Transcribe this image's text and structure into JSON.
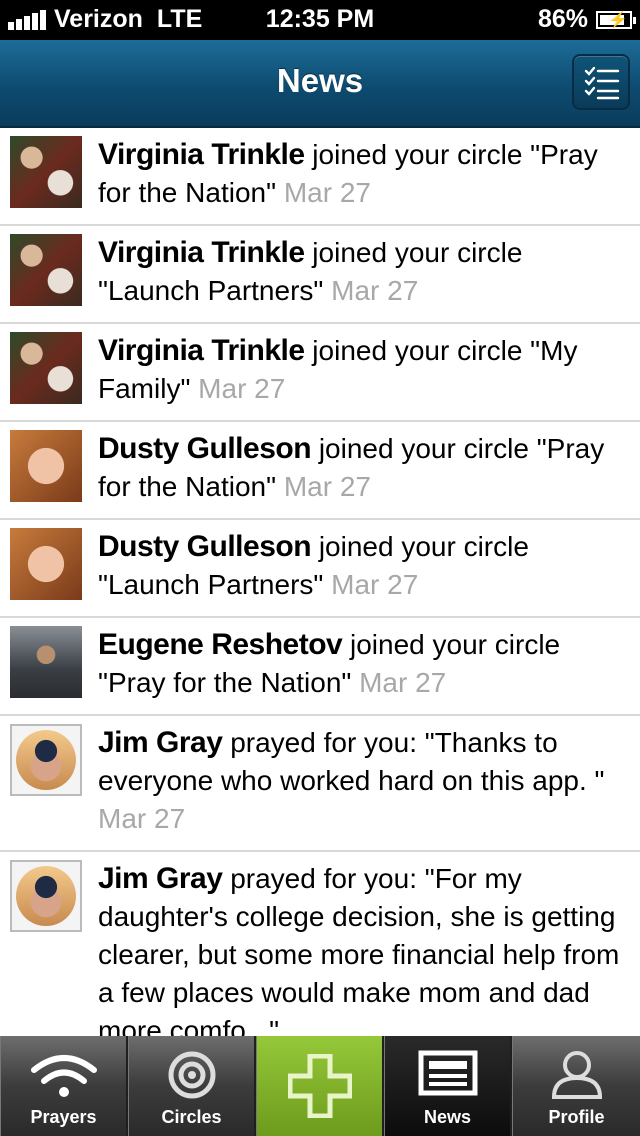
{
  "status": {
    "carrier": "Verizon",
    "network": "LTE",
    "time": "12:35 PM",
    "battery": "86%",
    "battery_level": 0.86
  },
  "nav": {
    "title": "News",
    "list_icon": "checklist-icon"
  },
  "feed": [
    {
      "avatar": "virginia",
      "name": "Virginia Trinkle",
      "text": " joined your circle \"Pray for the Nation\" ",
      "date": "Mar 27"
    },
    {
      "avatar": "virginia",
      "name": "Virginia Trinkle",
      "text": " joined your circle \"Launch Partners\" ",
      "date": "Mar 27"
    },
    {
      "avatar": "virginia",
      "name": "Virginia Trinkle",
      "text": " joined your circle \"My Family\" ",
      "date": "Mar 27"
    },
    {
      "avatar": "dusty",
      "name": "Dusty Gulleson",
      "text": " joined your circle \"Pray for the Nation\" ",
      "date": "Mar 27"
    },
    {
      "avatar": "dusty",
      "name": "Dusty Gulleson",
      "text": " joined your circle \"Launch Partners\" ",
      "date": "Mar 27"
    },
    {
      "avatar": "eugene",
      "name": "Eugene Reshetov",
      "text": " joined your circle \"Pray for the Nation\" ",
      "date": "Mar 27"
    },
    {
      "avatar": "jim",
      "name": "Jim Gray",
      "text": " prayed for you: \"Thanks to everyone who worked hard on this app. \" ",
      "date": "Mar 27"
    },
    {
      "avatar": "jim",
      "name": "Jim Gray",
      "text": " prayed for you: \"For my daughter's college decision, she is getting clearer, but some more financial help from a few places would make mom and dad more comfo...\"",
      "date": ""
    }
  ],
  "tabs": [
    {
      "label": "Prayers",
      "icon": "wifi-signal-icon"
    },
    {
      "label": "Circles",
      "icon": "target-circle-icon"
    },
    {
      "label": "",
      "icon": "plus-icon"
    },
    {
      "label": "News",
      "icon": "newspaper-icon"
    },
    {
      "label": "Profile",
      "icon": "person-icon"
    }
  ]
}
